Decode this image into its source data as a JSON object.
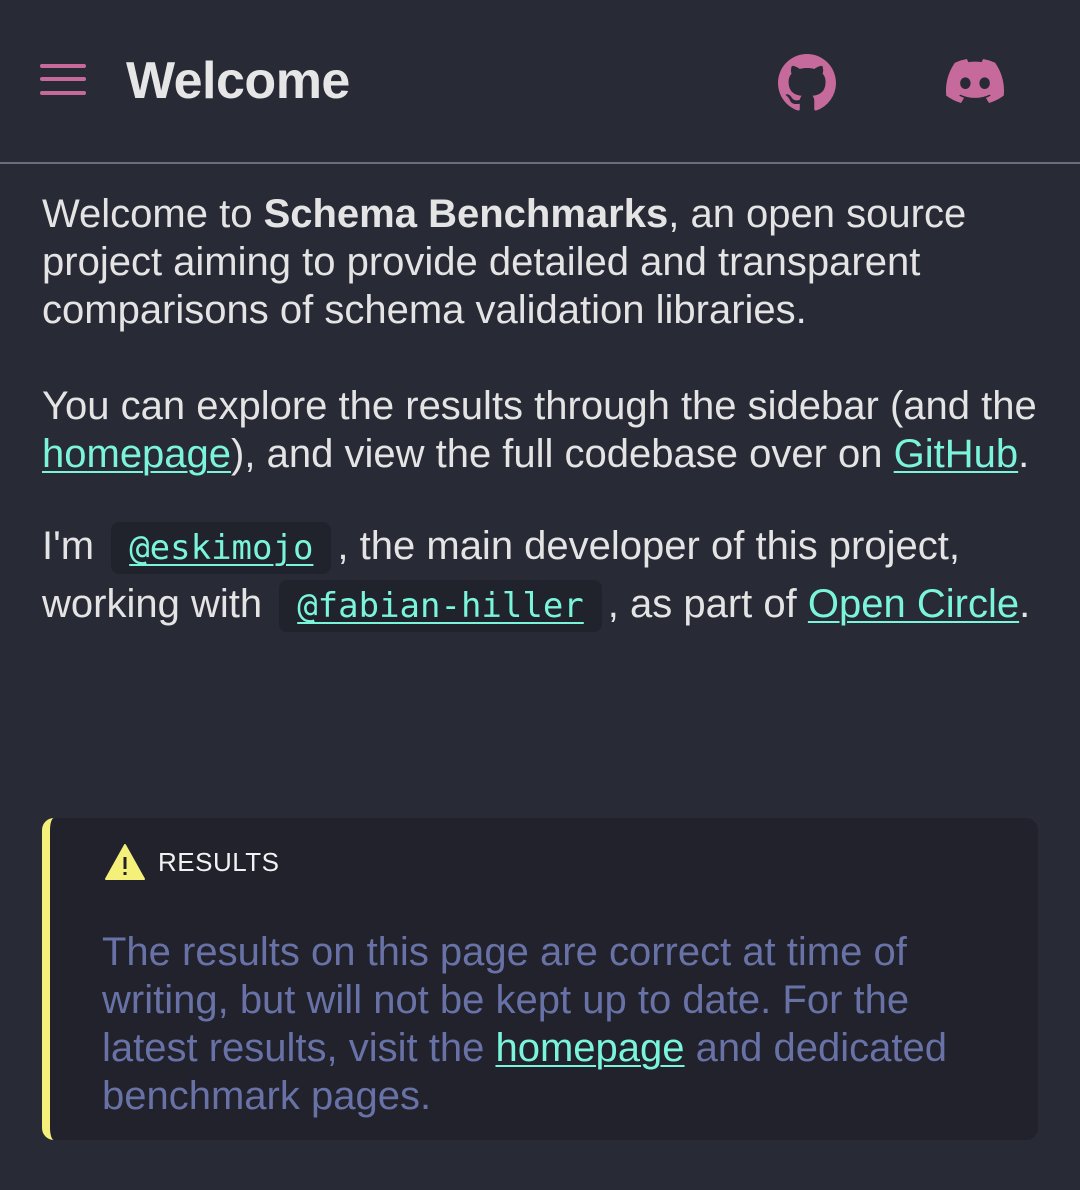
{
  "header": {
    "title": "Welcome",
    "menu_icon": "hamburger-menu-icon",
    "github_icon": "github-icon",
    "discord_icon": "discord-icon",
    "accent_color": "#c56a9a"
  },
  "intro": {
    "welcome_prefix": "Welcome to ",
    "project_name": "Schema Benchmarks",
    "welcome_suffix": ", an open source project aiming to provide detailed and transparent comparisons of schema validation libraries."
  },
  "explore": {
    "text1": "You can explore the results through the sidebar (and the ",
    "homepage_link": "homepage",
    "text2": "), and view the full codebase over on ",
    "github_link": "GitHub",
    "text3": "."
  },
  "credits": {
    "text1": "I'm ",
    "handle1": "@eskimojo",
    "text2": ", the main developer of this project, working with ",
    "handle2": "@fabian-hiller",
    "text3": ", as part of ",
    "org_link": "Open Circle",
    "text4": "."
  },
  "callout": {
    "icon": "warning-icon",
    "title": "RESULTS",
    "text1": "The results on this page are correct at time of writing, but will not be kept up to date. For the latest results, visit the ",
    "homepage_link": "homepage",
    "text2": " and dedicated benchmark pages.",
    "border_color": "#f4f07a"
  },
  "colors": {
    "background": "#282a36",
    "link": "#7af5dc",
    "callout_text": "#6872a6"
  }
}
